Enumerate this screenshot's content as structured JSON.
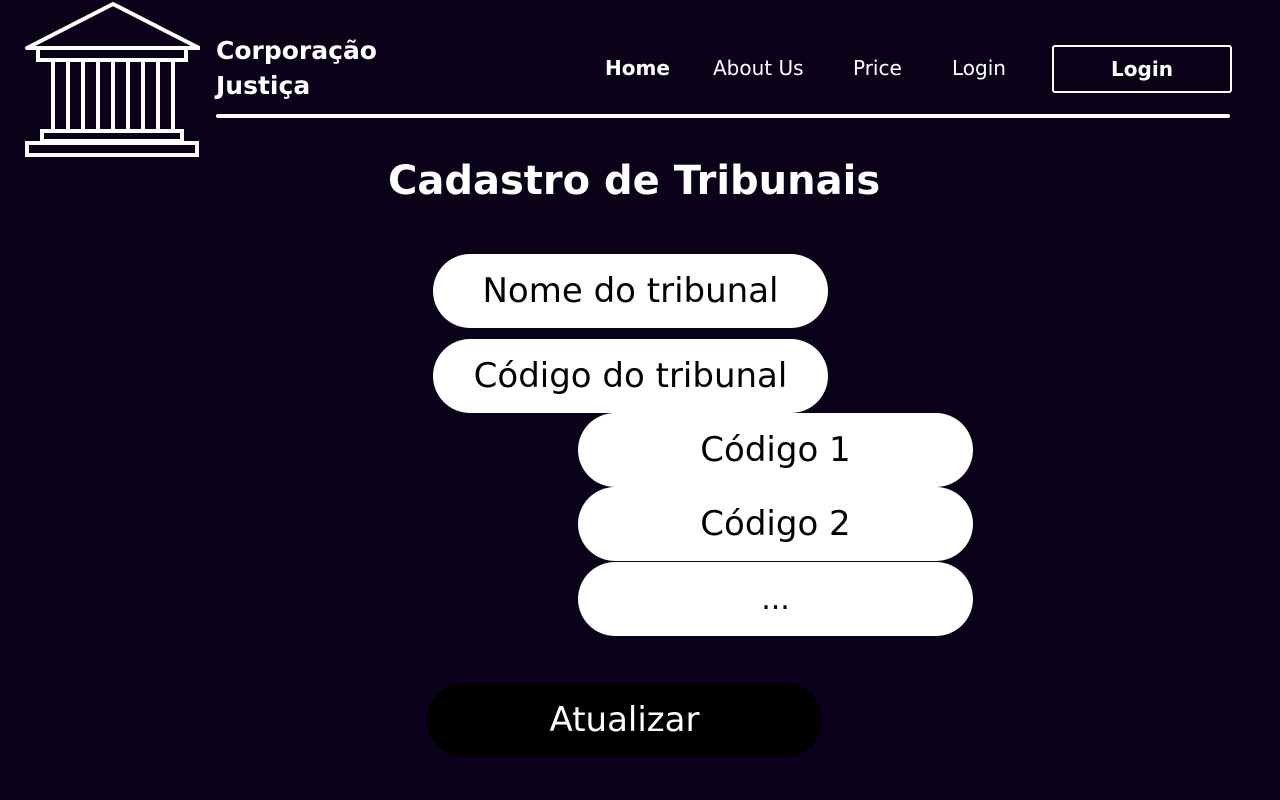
{
  "brand": {
    "line1": "Corporação",
    "line2": "Justiça",
    "logo_icon": "courthouse-icon"
  },
  "nav": {
    "items": [
      {
        "label": "Home",
        "active": true
      },
      {
        "label": "About Us",
        "active": false
      },
      {
        "label": "Price",
        "active": false
      },
      {
        "label": "Login",
        "active": false
      }
    ],
    "login_button": "Login"
  },
  "page": {
    "title": "Cadastro de Tribunais"
  },
  "form": {
    "court_name_field": "Nome do tribunal",
    "court_code_field": "Código do tribunal",
    "code_options": [
      "Código 1",
      "Código 2",
      "..."
    ],
    "submit_label": "Atualizar"
  },
  "colors": {
    "background": "#0a0219",
    "foreground": "#ffffff",
    "pill": "#ffffff",
    "button": "#000000"
  }
}
